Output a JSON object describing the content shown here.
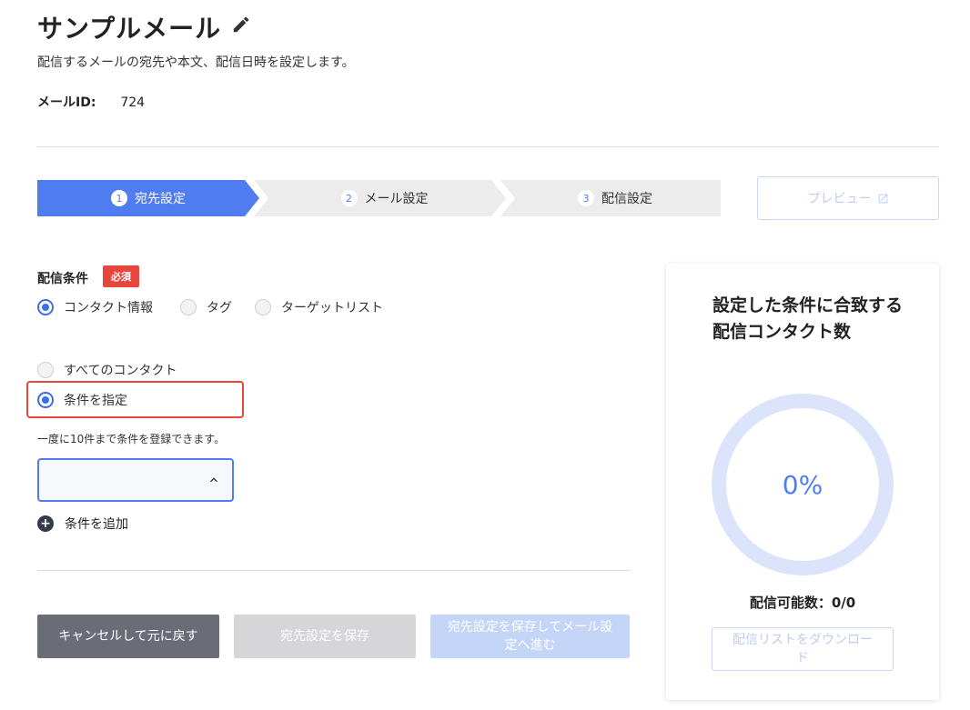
{
  "header": {
    "title": "サンプルメール",
    "description": "配信するメールの宛先や本文、配信日時を設定します。",
    "mail_id_label": "メールID:",
    "mail_id_value": "724"
  },
  "stepper": {
    "steps": [
      {
        "number": "1",
        "label": "宛先設定",
        "active": true
      },
      {
        "number": "2",
        "label": "メール設定",
        "active": false
      },
      {
        "number": "3",
        "label": "配信設定",
        "active": false
      }
    ]
  },
  "preview_button": "プレビュー",
  "conditions": {
    "label": "配信条件",
    "required_badge": "必須",
    "type_options": [
      {
        "label": "コンタクト情報",
        "checked": true
      },
      {
        "label": "タグ",
        "checked": false
      },
      {
        "label": "ターゲットリスト",
        "checked": false
      }
    ],
    "scope_options": [
      {
        "label": "すべてのコンタクト",
        "checked": false
      },
      {
        "label": "条件を指定",
        "checked": true
      }
    ],
    "hint": "一度に10件まで条件を登録できます。",
    "add_label": "条件を追加"
  },
  "buttons": {
    "cancel": "キャンセルして元に戻す",
    "save": "宛先設定を保存",
    "save_next": "宛先設定を保存してメール設定へ進む"
  },
  "summary": {
    "title": "設定した条件に合致する配信コンタクト数",
    "percent": "0%",
    "percent_value": 0,
    "deliverable": "配信可能数：0/0",
    "download": "配信リストをダウンロード"
  },
  "colors": {
    "primary": "#4f7df0",
    "required": "#e8453c",
    "donut_track": "#dbe4fb"
  }
}
